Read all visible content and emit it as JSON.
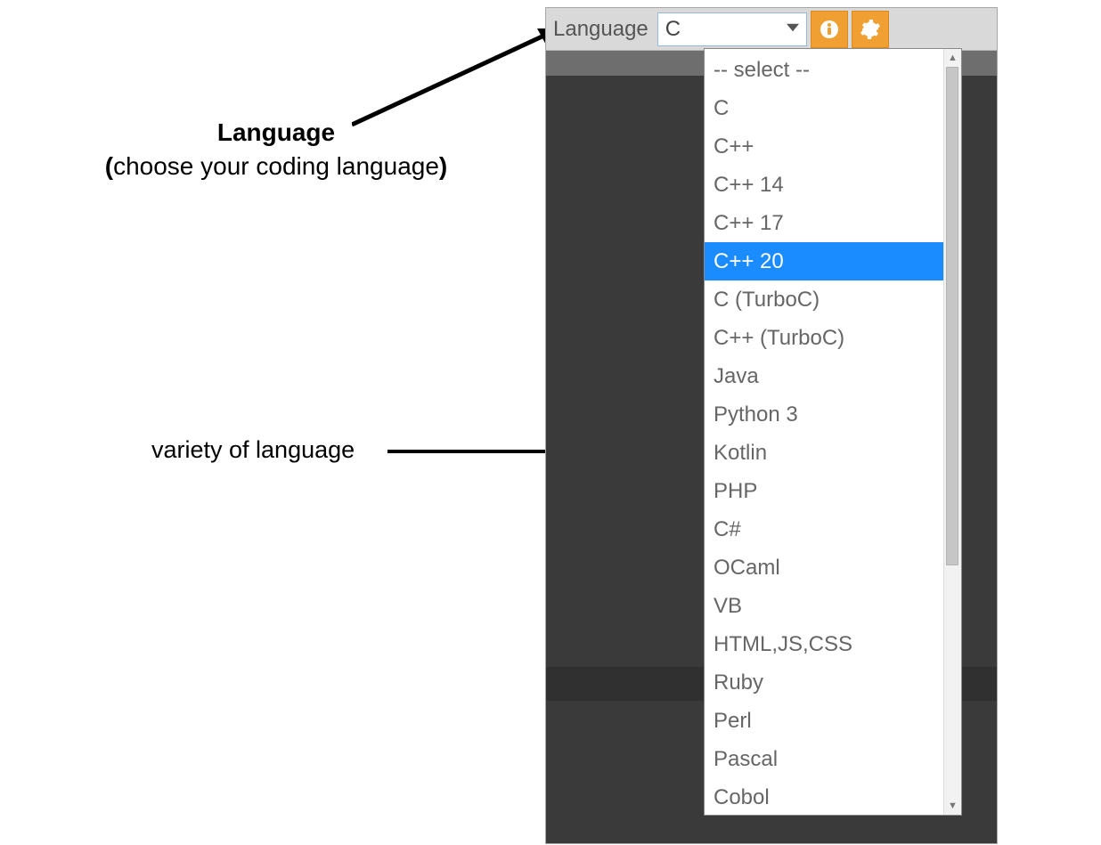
{
  "annotations": {
    "language_title": "Language",
    "language_subtitle": "(choose your coding language)",
    "variety_label": "variety of  language"
  },
  "toolbar": {
    "language_label": "Language",
    "selected_value": "C"
  },
  "dropdown": {
    "highlighted_index": 5,
    "items": [
      "-- select --",
      "C",
      "C++",
      "C++ 14",
      "C++ 17",
      "C++ 20",
      "C (TurboC)",
      "C++ (TurboC)",
      "Java",
      "Python 3",
      "Kotlin",
      "PHP",
      "C#",
      "OCaml",
      "VB",
      "HTML,JS,CSS",
      "Ruby",
      "Perl",
      "Pascal",
      "Cobol"
    ]
  }
}
